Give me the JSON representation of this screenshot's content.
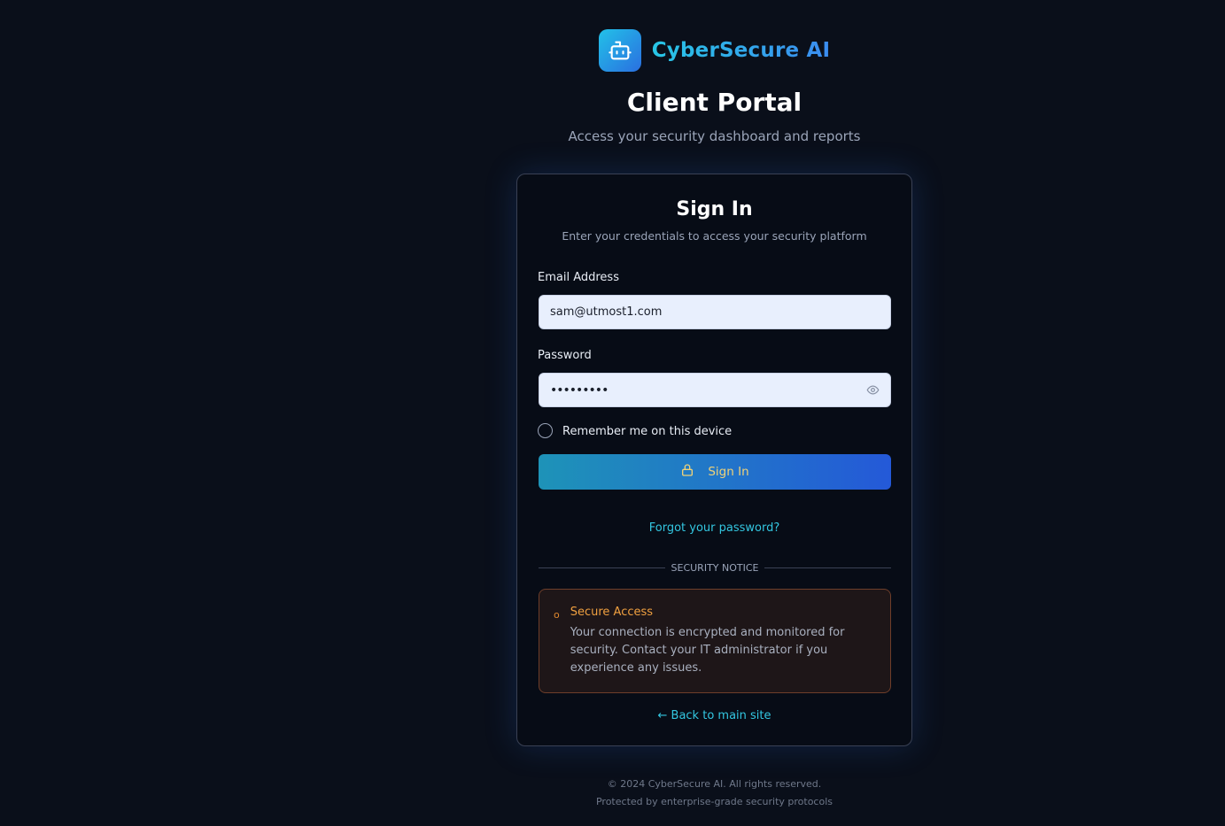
{
  "brand": {
    "name": "CyberSecure AI",
    "logo_icon": "robot-icon"
  },
  "header": {
    "title": "Client Portal",
    "subtitle": "Access your security dashboard and reports"
  },
  "card": {
    "title": "Sign In",
    "subtitle": "Enter your credentials to access your security platform",
    "email": {
      "label": "Email Address",
      "value": "sam@utmost1.com"
    },
    "password": {
      "label": "Password",
      "value": "•••••••••",
      "toggle_icon": "eye-icon"
    },
    "remember": {
      "label": "Remember me on this device",
      "checked": false
    },
    "signin_button": {
      "label": "Sign In",
      "icon": "lock-icon"
    },
    "forgot_link": "Forgot your password?",
    "divider_text": "SECURITY NOTICE",
    "notice": {
      "icon": "o",
      "title": "Secure Access",
      "text": "Your connection is encrypted and monitored for security. Contact your IT administrator if you experience any issues."
    },
    "back_link": "← Back to main site"
  },
  "footer": {
    "copyright": "© 2024 CyberSecure AI. All rights reserved.",
    "tagline": "Protected by enterprise-grade security protocols"
  },
  "colors": {
    "background": "#0a0f1a",
    "accent_cyan": "#33c6e0",
    "accent_blue": "#2459d8",
    "notice_orange": "#f0a040"
  }
}
